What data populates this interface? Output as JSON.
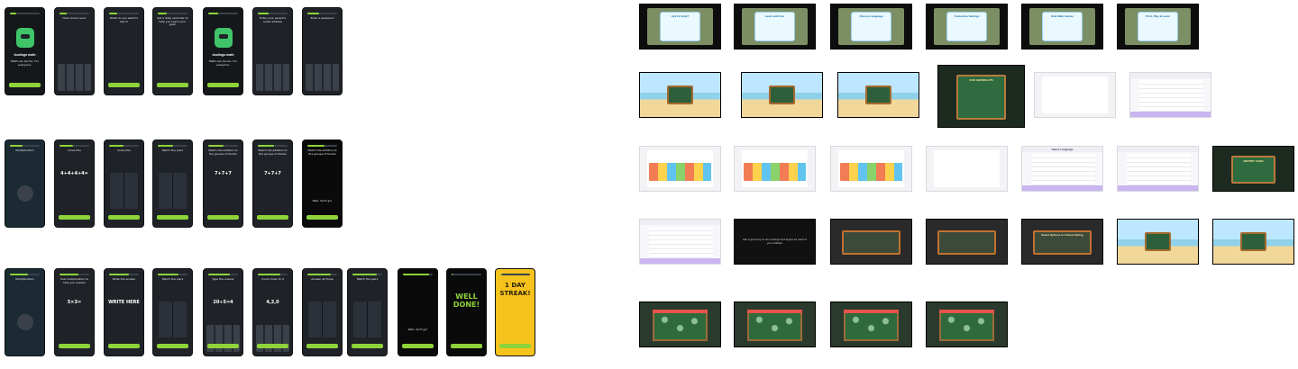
{
  "phones": [
    {
      "id": "p1",
      "style": "dark",
      "lines": [
        "duolingo math",
        "Math can be fun.",
        "For everyone."
      ],
      "button": "GET STARTED",
      "logo": true
    },
    {
      "id": "p2",
      "style": "",
      "lines": [
        "How old are you?"
      ],
      "button": "",
      "keys": true
    },
    {
      "id": "p3",
      "style": "",
      "lines": [
        "What do you want to learn?"
      ],
      "button": "NEXT"
    },
    {
      "id": "p4",
      "style": "",
      "lines": [
        "Set a daily reminder to help you reach your goal!"
      ],
      "button": "NEXT"
    },
    {
      "id": "p5",
      "style": "dark",
      "lines": [
        "duolingo math",
        "Math can be fun.",
        "For everyone."
      ],
      "button": "GET STARTED",
      "logo": true
    },
    {
      "id": "p6",
      "style": "",
      "lines": [
        "Enter your parent's email address"
      ],
      "button": "",
      "keys": true
    },
    {
      "id": "p7",
      "style": "",
      "lines": [
        "Enter a password"
      ],
      "button": "",
      "keys": true
    },
    {
      "id": "p8",
      "style": "blue",
      "lines": [
        "Multiplication"
      ],
      "button": "",
      "circle": true
    },
    {
      "id": "p9",
      "style": "",
      "lines": [
        "Solve this"
      ],
      "eq": "4+4+4+4=",
      "button": "CONTINUE"
    },
    {
      "id": "p10",
      "style": "",
      "lines": [
        "Solve this"
      ],
      "button": "CONTINUE",
      "grid": true
    },
    {
      "id": "p11",
      "style": "",
      "lines": [
        "Match the pairs"
      ],
      "button": "CONTINUE",
      "grid": true
    },
    {
      "id": "p12",
      "style": "",
      "lines": [
        "Match the addition to the groups of blocks"
      ],
      "eq": "7+7+7",
      "button": "CONTINUE"
    },
    {
      "id": "p13",
      "style": "",
      "lines": [
        "Match the addition to the groups of blocks"
      ],
      "eq": "7+7+7",
      "button": "CONTINUE"
    },
    {
      "id": "p14",
      "style": "black",
      "lines": [
        "Match the addition to the groups of blocks"
      ],
      "button": "CONTINUE",
      "note": "Well, don't go!"
    },
    {
      "id": "p15",
      "style": "blue",
      "lines": [
        "Multiplication"
      ],
      "button": "",
      "circle": true
    },
    {
      "id": "p16",
      "style": "",
      "lines": [
        "Use multiplication to help you answer"
      ],
      "eq": "5×3=",
      "button": "CONTINUE"
    },
    {
      "id": "p17",
      "style": "",
      "lines": [
        "Write the answer"
      ],
      "eq": "WRITE HERE",
      "button": "CONTINUE"
    },
    {
      "id": "p18",
      "style": "",
      "lines": [
        "Match the pairs"
      ],
      "button": "CONTINUE",
      "grid": true
    },
    {
      "id": "p19",
      "style": "",
      "lines": [
        "Type the answer"
      ],
      "eq": "20÷5=4",
      "button": "CONTINUE",
      "keys": true
    },
    {
      "id": "p20",
      "style": "",
      "lines": [
        "Count down to 0"
      ],
      "eq": "4,2,0",
      "button": "CONTINUE",
      "keys": true
    },
    {
      "id": "p21",
      "style": "",
      "lines": [
        "Answer all three"
      ],
      "button": "CONTINUE",
      "grid": true
    },
    {
      "id": "p22",
      "style": "",
      "lines": [
        "Match the pairs"
      ],
      "button": "CONTINUE",
      "grid": true
    },
    {
      "id": "p23",
      "style": "",
      "lines": [
        "Match the pairs"
      ],
      "button": "CONTINUE",
      "grid": true
    },
    {
      "id": "p24",
      "style": "black",
      "lines": [
        ""
      ],
      "button": "CONTINUE",
      "note": "Well, don't go!"
    },
    {
      "id": "p25",
      "style": "black",
      "big": "WELL DONE!",
      "button": "CONTINUE"
    },
    {
      "id": "p26",
      "style": "yellow",
      "big": "1 DAY STREAK!",
      "button": "CONTINUE"
    }
  ],
  "tabs": [
    {
      "id": "t1",
      "kind": "card",
      "label": "Ask for Help?"
    },
    {
      "id": "t2",
      "kind": "card",
      "label": "Learn with Fun"
    },
    {
      "id": "t3",
      "kind": "card",
      "label": "Choose Language"
    },
    {
      "id": "t4",
      "kind": "card",
      "label": "Customize Settings"
    },
    {
      "id": "t5",
      "kind": "card",
      "label": "Kids Math Games"
    },
    {
      "id": "t6",
      "kind": "card",
      "label": "Print, Play & Learn"
    },
    {
      "id": "t7",
      "kind": "beach",
      "label": ""
    },
    {
      "id": "t8",
      "kind": "beach",
      "label": ""
    },
    {
      "id": "t9",
      "kind": "beach",
      "label": ""
    },
    {
      "id": "t10",
      "kind": "chalk",
      "label": "FOR GROWN-UPS"
    },
    {
      "id": "t11",
      "kind": "plain",
      "label": ""
    },
    {
      "id": "t12",
      "kind": "light",
      "label": ""
    },
    {
      "id": "t13",
      "kind": "plain",
      "label": "",
      "thumbs": true
    },
    {
      "id": "t14",
      "kind": "plain",
      "label": "",
      "thumbs": true
    },
    {
      "id": "t15",
      "kind": "plain",
      "label": "",
      "thumbs": true
    },
    {
      "id": "t16",
      "kind": "plain",
      "label": ""
    },
    {
      "id": "t17",
      "kind": "light",
      "label": "Select Language"
    },
    {
      "id": "t18",
      "kind": "light",
      "label": ""
    },
    {
      "id": "t19",
      "kind": "chalk",
      "label": "REPORT CARD"
    },
    {
      "id": "t20",
      "kind": "light",
      "label": ""
    },
    {
      "id": "t21",
      "kind": "dark",
      "label": "Ask a grown-up to see settings and logout for each of your children"
    },
    {
      "id": "t22",
      "kind": "panel",
      "label": ""
    },
    {
      "id": "t23",
      "kind": "panel",
      "label": ""
    },
    {
      "id": "t24",
      "kind": "panel",
      "label": "Select Options to Unlock Setting"
    },
    {
      "id": "t25",
      "kind": "beach",
      "label": ""
    },
    {
      "id": "t26",
      "kind": "beach",
      "label": ""
    },
    {
      "id": "t27",
      "kind": "doodle",
      "label": ""
    },
    {
      "id": "t28",
      "kind": "doodle",
      "label": ""
    },
    {
      "id": "t29",
      "kind": "doodle",
      "label": ""
    },
    {
      "id": "t30",
      "kind": "doodle",
      "label": ""
    }
  ]
}
